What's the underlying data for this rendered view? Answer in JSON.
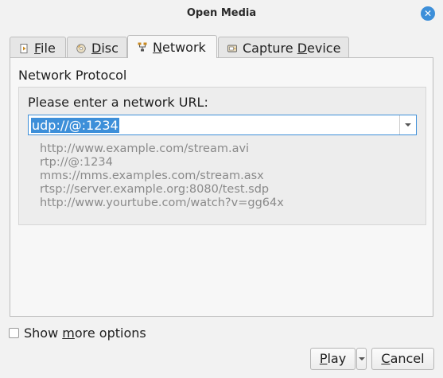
{
  "window": {
    "title": "Open Media",
    "close_glyph": "✕"
  },
  "tabs": [
    {
      "label_prefix": "",
      "mnemonic": "F",
      "label_suffix": "ile",
      "icon": "file-icon",
      "active": false
    },
    {
      "label_prefix": "",
      "mnemonic": "D",
      "label_suffix": "isc",
      "icon": "disc-icon",
      "active": false
    },
    {
      "label_prefix": "",
      "mnemonic": "N",
      "label_suffix": "etwork",
      "icon": "network-icon",
      "active": true
    },
    {
      "label_prefix": "Capture ",
      "mnemonic": "D",
      "label_suffix": "evice",
      "icon": "capture-device-icon",
      "active": false
    }
  ],
  "network": {
    "group_title": "Network Protocol",
    "url_label": "Please enter a network URL:",
    "url_value": "udp://@:1234",
    "examples": [
      "http://www.example.com/stream.avi",
      "rtp://@:1234",
      "mms://mms.examples.com/stream.asx",
      "rtsp://server.example.org:8080/test.sdp",
      "http://www.yourtube.com/watch?v=gg64x"
    ]
  },
  "options": {
    "show_more_prefix": "Show ",
    "show_more_mnemonic": "m",
    "show_more_suffix": "ore options",
    "checked": false
  },
  "buttons": {
    "play_mnemonic": "P",
    "play_suffix": "lay",
    "cancel_mnemonic": "C",
    "cancel_suffix": "ancel"
  },
  "colors": {
    "accent": "#3d8fd9",
    "window_bg": "#f2f2f2",
    "example_text": "#8a8a8a"
  }
}
